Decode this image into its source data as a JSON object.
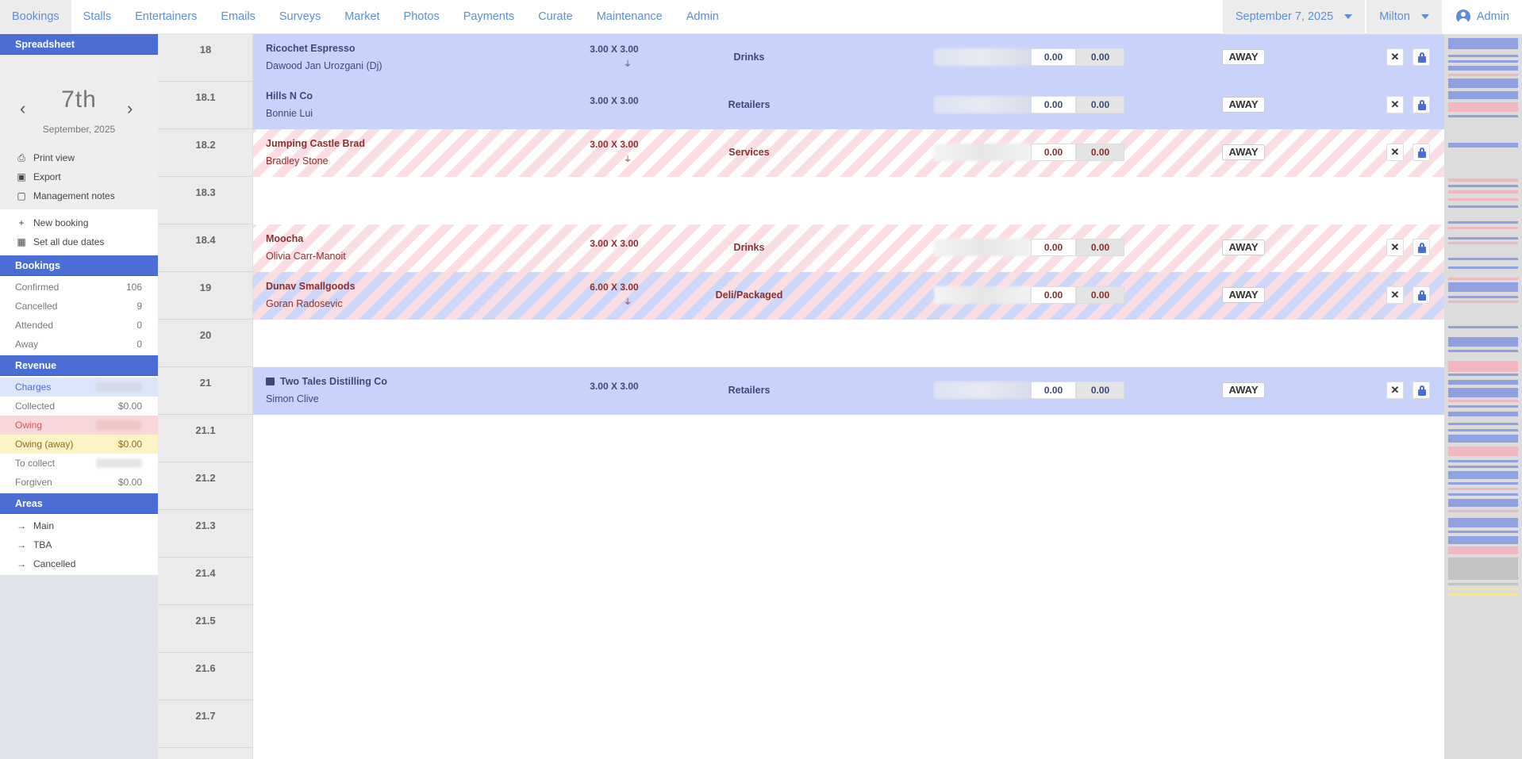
{
  "nav": {
    "items": [
      "Bookings",
      "Stalls",
      "Entertainers",
      "Emails",
      "Surveys",
      "Market",
      "Photos",
      "Payments",
      "Curate",
      "Maintenance",
      "Admin"
    ],
    "date_select": "September 7, 2025",
    "location_select": "Milton",
    "user_label": "Admin"
  },
  "sidebar": {
    "spreadsheet_header": "Spreadsheet",
    "day": "7th",
    "month_year": "September, 2025",
    "actions": [
      "Print view",
      "Export",
      "Management notes"
    ],
    "actions2": [
      "New booking",
      "Set all due dates"
    ],
    "bookings_header": "Bookings",
    "bookings": [
      {
        "label": "Confirmed",
        "value": "106"
      },
      {
        "label": "Cancelled",
        "value": "9"
      },
      {
        "label": "Attended",
        "value": "0"
      },
      {
        "label": "Away",
        "value": "0"
      }
    ],
    "revenue_header": "Revenue",
    "revenue": [
      {
        "label": "Charges",
        "value": ""
      },
      {
        "label": "Collected",
        "value": "$0.00"
      },
      {
        "label": "Owing",
        "value": ""
      },
      {
        "label": "Owing (away)",
        "value": "$0.00"
      },
      {
        "label": "To collect",
        "value": ""
      },
      {
        "label": "Forgiven",
        "value": "$0.00"
      }
    ],
    "areas_header": "Areas",
    "areas": [
      "Main",
      "TBA",
      "Cancelled"
    ]
  },
  "sites": [
    "18",
    "18.1",
    "18.2",
    "18.3",
    "18.4",
    "19",
    "20",
    "21",
    "21.1",
    "21.2",
    "21.3",
    "21.4",
    "21.5",
    "21.6",
    "21.7"
  ],
  "bookings": [
    {
      "name": "Ricochet Espresso",
      "contact": "Dawood Jan Urozgani (Dj)",
      "size": "3.00 X 3.00",
      "category": "Drinks",
      "val_a": "0.00",
      "val_b": "0.00",
      "status": "AWAY"
    },
    {
      "name": "Hills N Co",
      "contact": "Bonnie Lui",
      "size": "3.00 X 3.00",
      "category": "Retailers",
      "val_a": "0.00",
      "val_b": "0.00",
      "status": "AWAY"
    },
    {
      "name": "Jumping Castle Brad",
      "contact": "Bradley Stone",
      "size": "3.00 X 3.00",
      "category": "Services",
      "val_a": "0.00",
      "val_b": "0.00",
      "status": "AWAY"
    },
    {
      "name": "Moocha",
      "contact": "Olivia Carr-Manoit",
      "size": "3.00 X 3.00",
      "category": "Drinks",
      "val_a": "0.00",
      "val_b": "0.00",
      "status": "AWAY"
    },
    {
      "name": "Dunav Smallgoods",
      "contact": "Goran Radosevic",
      "size": "6.00 X 3.00",
      "category": "Deli/Packaged",
      "val_a": "0.00",
      "val_b": "0.00",
      "status": "AWAY"
    },
    {
      "name": "Two Tales Distilling Co",
      "contact": "Simon Clive",
      "size": "3.00 X 3.00",
      "category": "Retailers",
      "val_a": "0.00",
      "val_b": "0.00",
      "status": "AWAY"
    }
  ],
  "colors": {
    "accent": "#4a6ed6",
    "nav_link": "#5b8fd9",
    "row_blue": "#c7d3fb",
    "row_pink": "#fbdde4"
  }
}
